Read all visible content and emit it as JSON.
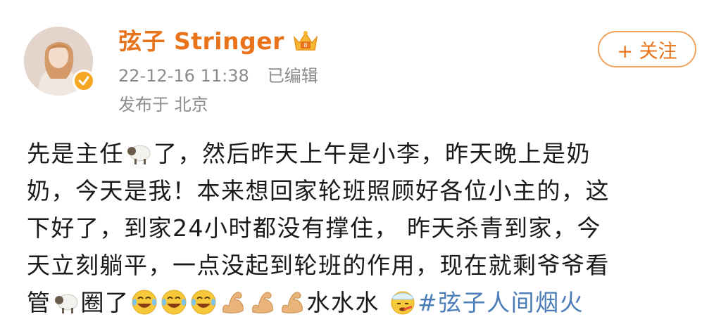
{
  "user": {
    "name": "弦子 Stringer",
    "timestamp": "22-12-16 11:38",
    "edited_label": "已编辑",
    "location": "发布于 北京",
    "follow_label": "+ 关注"
  },
  "post": {
    "line1_a": "先是主任",
    "line1_b": "了，然后昨天上午是小李，昨天晚上是奶",
    "line2": "奶，今天是我！本来想回家轮班照顾好各位小主的，这",
    "line3": "下好了，到家24小时都没有撑住， 昨天杀青到家，今",
    "line4": "天立刻躺平，一点没起到轮班的作用，现在就剩爷爷看",
    "line5_a": "管",
    "line5_b": "圈了",
    "line5_c": "水水水",
    "hashtag": "#弦子人间烟火"
  },
  "icons": {
    "verified": "verified-badge-icon",
    "crown": "vip-crown-icon",
    "sheep": "sheep-emoji-icon",
    "laugh": "laugh-cry-emoji-icon",
    "muscle": "muscle-emoji-icon",
    "sick": "sick-emoji-icon"
  },
  "colors": {
    "username": "#e8731a",
    "meta": "#8c8c8c",
    "hashtag": "#4a7db8",
    "follow_border": "#f0a35c"
  }
}
